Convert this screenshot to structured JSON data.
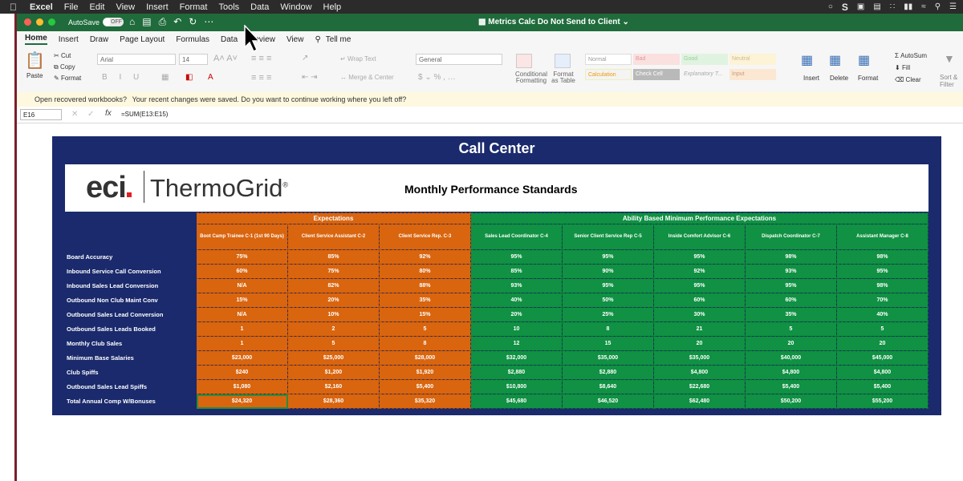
{
  "menubar": {
    "app": "Excel",
    "items": [
      "File",
      "Edit",
      "View",
      "Insert",
      "Format",
      "Tools",
      "Data",
      "Window",
      "Help"
    ]
  },
  "window": {
    "autosave_label": "AutoSave",
    "autosave_state": "OFF",
    "doc_title": "Metrics Calc Do Not Send to Client"
  },
  "tabs": [
    "Home",
    "Insert",
    "Draw",
    "Page Layout",
    "Formulas",
    "Data",
    "Review",
    "View",
    "Tell me"
  ],
  "ribbon": {
    "paste": "Paste",
    "cut": "Cut",
    "copy": "Copy",
    "format": "Format",
    "font": "Arial",
    "size": "14",
    "wrap_text": "Wrap Text",
    "merge_center": "Merge & Center",
    "number_format": "General",
    "conditional_formatting": "Conditional Formatting",
    "format_as_table": "Format as Table",
    "styles": [
      "Normal",
      "Bad",
      "Good",
      "Neutral",
      "Calculation",
      "Check Cell",
      "Explanatory T...",
      "Input"
    ],
    "insert": "Insert",
    "delete": "Delete",
    "format_cells": "Format",
    "autosum": "AutoSum",
    "fill": "Fill",
    "clear": "Clear",
    "sort": "Sort & Filter"
  },
  "infobar": {
    "title": "Open recovered workbooks?",
    "message": "Your recent changes were saved. Do you want to continue working where you left off?"
  },
  "formula": {
    "cell_ref": "E16",
    "fx": "fx",
    "value": "=SUM(E13:E15)"
  },
  "sheet": {
    "title": "Call Center",
    "logo_eci": "eci",
    "logo_name": "ThermoGrid",
    "subtitle": "Monthly Performance Standards",
    "group_expectations": "Expectations",
    "group_ability": "Ability Based Minimum Performance Expectations",
    "columns": [
      "Boot Camp Trainee C-1 (1st 90 Days)",
      "Client Service Assistant C-2",
      "Client Service Rep. C-3",
      "Sales Lead Coordinator C-4",
      "Senior Client Service Rep C-5",
      "Inside Comfort Advisor C-6",
      "Dispatch Coordinator C-7",
      "Assistant Manager   C-8"
    ],
    "rows": [
      {
        "label": "Board Accuracy",
        "values": [
          "75%",
          "85%",
          "92%",
          "95%",
          "95%",
          "95%",
          "98%",
          "98%"
        ]
      },
      {
        "label": "Inbound Service Call Conversion",
        "values": [
          "60%",
          "75%",
          "80%",
          "85%",
          "90%",
          "92%",
          "93%",
          "95%"
        ]
      },
      {
        "label": "Inbound Sales Lead Conversion",
        "values": [
          "N/A",
          "82%",
          "88%",
          "93%",
          "95%",
          "95%",
          "95%",
          "98%"
        ]
      },
      {
        "label": "Outbound Non Club Maint Conv",
        "values": [
          "15%",
          "20%",
          "35%",
          "40%",
          "50%",
          "60%",
          "60%",
          "70%"
        ]
      },
      {
        "label": "Outbound Sales Lead Conversion",
        "values": [
          "N/A",
          "10%",
          "15%",
          "20%",
          "25%",
          "30%",
          "35%",
          "40%"
        ]
      },
      {
        "label": "Outbound Sales Leads Booked",
        "values": [
          "1",
          "2",
          "5",
          "10",
          "8",
          "21",
          "5",
          "5"
        ]
      },
      {
        "label": "Monthly Club Sales",
        "values": [
          "1",
          "5",
          "8",
          "12",
          "15",
          "20",
          "20",
          "20"
        ]
      },
      {
        "label": "Minimum Base Salaries",
        "values": [
          "$23,000",
          "$25,000",
          "$28,000",
          "$32,000",
          "$35,000",
          "$35,000",
          "$40,000",
          "$45,000"
        ]
      },
      {
        "label": "Club Spiffs",
        "values": [
          "$240",
          "$1,200",
          "$1,920",
          "$2,880",
          "$2,880",
          "$4,800",
          "$4,800",
          "$4,800"
        ]
      },
      {
        "label": "Outbound Sales Lead Spiffs",
        "values": [
          "$1,080",
          "$2,160",
          "$5,400",
          "$10,800",
          "$8,640",
          "$22,680",
          "$5,400",
          "$5,400"
        ]
      },
      {
        "label": "Total Annual Comp W/Bonuses",
        "values": [
          "$24,320",
          "$28,360",
          "$35,320",
          "$45,680",
          "$46,520",
          "$62,480",
          "$50,200",
          "$55,200"
        ]
      }
    ]
  },
  "colors": {
    "navy": "#1a2a6c",
    "orange": "#d9650f",
    "green": "#109143",
    "excel_green": "#1f6b3b"
  }
}
